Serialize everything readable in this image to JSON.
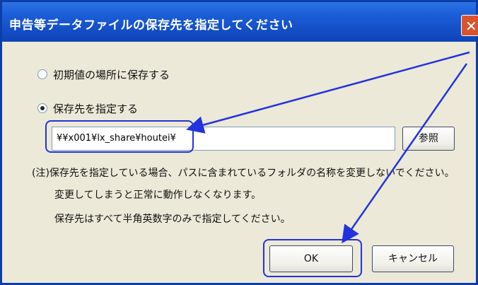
{
  "window": {
    "title": "申告等データファイルの保存先を指定してください",
    "close_symbol": "✕"
  },
  "options": [
    {
      "label": "初期値の場所に保存する",
      "selected": false
    },
    {
      "label": "保存先を指定する",
      "selected": true
    }
  ],
  "path_field": {
    "value": "¥¥x001¥lx_share¥houtei¥"
  },
  "buttons": {
    "browse": "参照",
    "ok": "OK",
    "cancel": "キャンセル"
  },
  "notes": {
    "line1": "(注)保存先を指定している場合、パスに含まれているフォルダの名称を変更しないでください。",
    "line2": "変更してしまうと正常に動作しなくなります。",
    "line3": "保存先はすべて半角英数字のみで指定してください。"
  },
  "colors": {
    "title_bar": "#1b5fd8",
    "dialog_bg": "#ece9d8",
    "annotation": "#2233dd",
    "close_button": "#d9542d"
  }
}
